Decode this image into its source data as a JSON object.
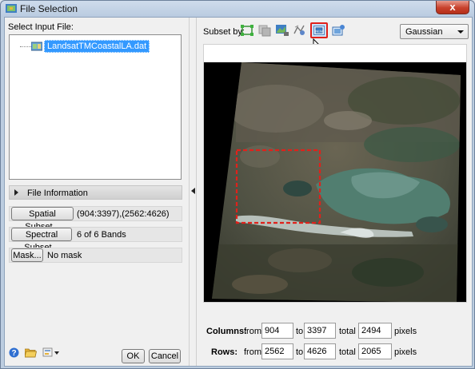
{
  "window": {
    "title": "File Selection",
    "close_label": "x"
  },
  "left": {
    "select_input_label": "Select Input File:",
    "file_name": "LandsatTMCoastalLA.dat",
    "file_info_label": "File Information",
    "spatial_subset_button": "Spatial Subset...",
    "spatial_subset_value": "(904:3397),(2562:4626)",
    "spectral_subset_button": "Spectral Subset...",
    "spectral_subset_value": "6 of 6 Bands",
    "mask_button": "Mask...",
    "mask_value": "No mask",
    "ok_button": "OK",
    "cancel_button": "Cancel"
  },
  "right": {
    "subset_by_label": "Subset by:",
    "tools": [
      "full-extent-icon",
      "raster-subset-icon",
      "vector-subset-icon",
      "roi-subset-icon",
      "view-subset-icon",
      "file-subset-icon"
    ],
    "selected_tool": "view-subset-icon",
    "resampling_value": "Gaussian",
    "columns": {
      "label": "Columns:",
      "from_label": "from",
      "from": "904",
      "to_label": "to",
      "to": "3397",
      "total_label": "total",
      "total": "2494",
      "unit": "pixels"
    },
    "rows": {
      "label": "Rows:",
      "from_label": "from",
      "from": "2562",
      "to_label": "to",
      "to": "4626",
      "total_label": "total",
      "total": "2065",
      "unit": "pixels"
    }
  },
  "colors": {
    "selection": "#3399ff",
    "highlight_border": "#e0211b",
    "subset_box": "#e0211b"
  }
}
